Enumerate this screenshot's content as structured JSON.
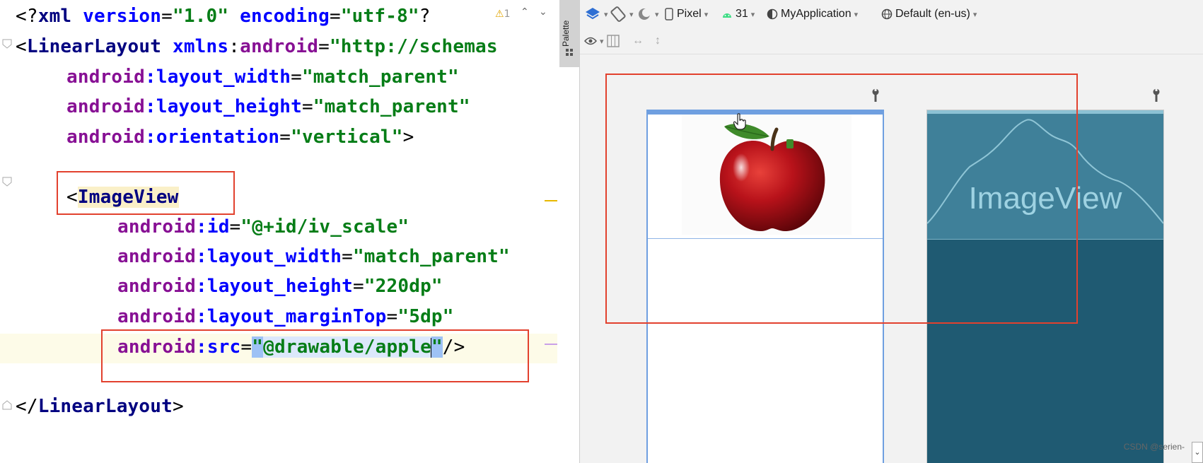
{
  "editor": {
    "lines": {
      "l1": {
        "open": "<?",
        "kw": "xml",
        "a1": "version",
        "v1": "\"1.0\"",
        "a2": "encoding",
        "v2": "\"utf-8\"",
        "close": "?"
      },
      "l2": {
        "open": "<",
        "tag": "LinearLayout",
        "ns": "xmlns",
        "colon": ":",
        "attr": "android",
        "eq": "=",
        "val": "\"http://schemas"
      },
      "l3": {
        "ns": "android",
        "attr": ":layout_width",
        "eq": "=",
        "val": "\"match_parent\""
      },
      "l4": {
        "ns": "android",
        "attr": ":layout_height",
        "eq": "=",
        "val": "\"match_parent\""
      },
      "l5": {
        "ns": "android",
        "attr": ":orientation",
        "eq": "=",
        "val": "\"vertical\"",
        "close": ">"
      },
      "l7": {
        "open": "<",
        "tag": "ImageView"
      },
      "l8": {
        "ns": "android",
        "attr": ":id",
        "eq": "=",
        "val": "\"@+id/iv_scale\""
      },
      "l9": {
        "ns": "android",
        "attr": ":layout_width",
        "eq": "=",
        "val": "\"match_parent\""
      },
      "l10": {
        "ns": "android",
        "attr": ":layout_height",
        "eq": "=",
        "val": "\"220dp\""
      },
      "l11": {
        "ns": "android",
        "attr": ":layout_marginTop",
        "eq": "=",
        "val": "\"5dp\""
      },
      "l12": {
        "ns": "android",
        "attr": ":src",
        "eq": "=",
        "q1": "\"",
        "val": "@drawable/apple",
        "q2": "\"",
        "close": "/>"
      },
      "l14": {
        "open": "</",
        "tag": "LinearLayout",
        "close": ">"
      }
    },
    "warning_count": "1",
    "warning_icon": "warning-triangle-icon"
  },
  "palette": {
    "label": "Palette"
  },
  "toolbar": {
    "device": "Pixel",
    "api": "31",
    "theme": "MyApplication",
    "locale": "Default (en-us)"
  },
  "design": {
    "blueprint_label": "ImageView",
    "watermark": "CSDN @serien-"
  },
  "colors": {
    "annotation_red": "#e2412e",
    "blueprint_bg": "#1f5a72",
    "selection_blue": "#6f9fe0"
  }
}
